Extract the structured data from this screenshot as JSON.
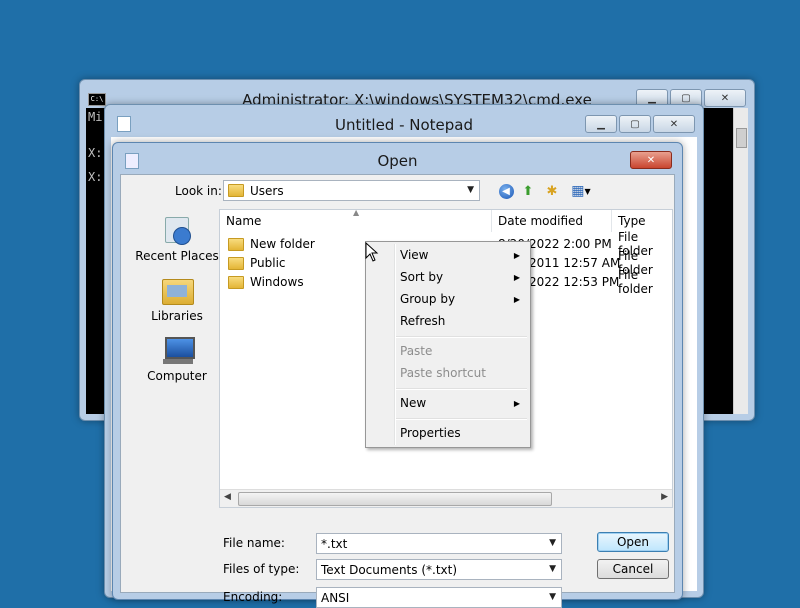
{
  "cmd": {
    "title": "Administrator: X:\\windows\\SYSTEM32\\cmd.exe",
    "lines": [
      "Mi",
      "",
      "",
      "X:",
      "",
      "X:"
    ]
  },
  "notepad": {
    "title": "Untitled - Notepad"
  },
  "dialog": {
    "title": "Open",
    "look_in_label": "Look in:",
    "look_in_value": "Users",
    "places": [
      {
        "label": "Recent Places",
        "icon": "recent-places-icon"
      },
      {
        "label": "Libraries",
        "icon": "libraries-icon"
      },
      {
        "label": "Computer",
        "icon": "computer-icon"
      }
    ],
    "columns": [
      "Name",
      "Date modified",
      "Type"
    ],
    "files": [
      {
        "name": "New folder",
        "date": "8/20/2022 2:00 PM",
        "type": "File folder"
      },
      {
        "name": "Public",
        "date": "7/14/2011 12:57 AM",
        "type": "File folder"
      },
      {
        "name": "Windows",
        "date": "8/20/2022 12:53 PM",
        "type": "File folder"
      }
    ],
    "file_name_label": "File name:",
    "file_name_value": "*.txt",
    "files_of_type_label": "Files of type:",
    "files_of_type_value": "Text Documents (*.txt)",
    "encoding_label": "Encoding:",
    "encoding_value": "ANSI",
    "open_button": "Open",
    "cancel_button": "Cancel"
  },
  "context_menu": {
    "items": [
      {
        "label": "View",
        "submenu": true,
        "enabled": true
      },
      {
        "label": "Sort by",
        "submenu": true,
        "enabled": true
      },
      {
        "label": "Group by",
        "submenu": true,
        "enabled": true
      },
      {
        "label": "Refresh",
        "submenu": false,
        "enabled": true
      },
      {
        "label": "Paste",
        "submenu": false,
        "enabled": false
      },
      {
        "label": "Paste shortcut",
        "submenu": false,
        "enabled": false
      },
      {
        "label": "New",
        "submenu": true,
        "enabled": true
      },
      {
        "label": "Properties",
        "submenu": false,
        "enabled": true
      }
    ]
  },
  "colors": {
    "desktop": "#1f6fa8",
    "frame": "#b7cde6",
    "close": "#c9452f"
  }
}
